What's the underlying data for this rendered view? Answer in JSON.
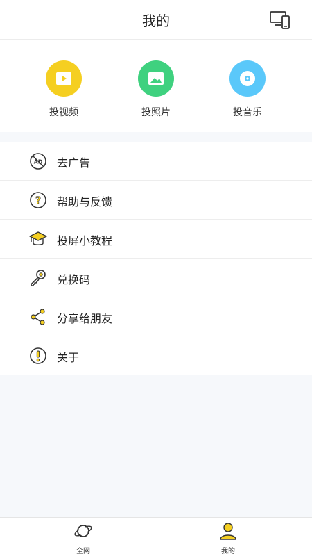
{
  "header": {
    "title": "我的"
  },
  "quick_actions": [
    {
      "label": "投视频",
      "icon": "video-icon",
      "color": "#f5cf21"
    },
    {
      "label": "投照片",
      "icon": "photo-icon",
      "color": "#3fd17f"
    },
    {
      "label": "投音乐",
      "icon": "music-disc-icon",
      "color": "#5ac8fa"
    }
  ],
  "menu": [
    {
      "label": "去广告",
      "icon": "no-ad-icon"
    },
    {
      "label": "帮助与反馈",
      "icon": "help-icon"
    },
    {
      "label": "投屏小教程",
      "icon": "graduation-cap-icon"
    },
    {
      "label": "兑换码",
      "icon": "key-icon"
    },
    {
      "label": "分享给朋友",
      "icon": "share-icon"
    },
    {
      "label": "关于",
      "icon": "info-icon"
    }
  ],
  "tabbar": [
    {
      "label": "全网",
      "icon": "planet-icon"
    },
    {
      "label": "我的",
      "icon": "user-icon",
      "active": true
    }
  ],
  "colors": {
    "accent": "#f5cf21",
    "green": "#3fd17f",
    "blue": "#5ac8fa"
  }
}
